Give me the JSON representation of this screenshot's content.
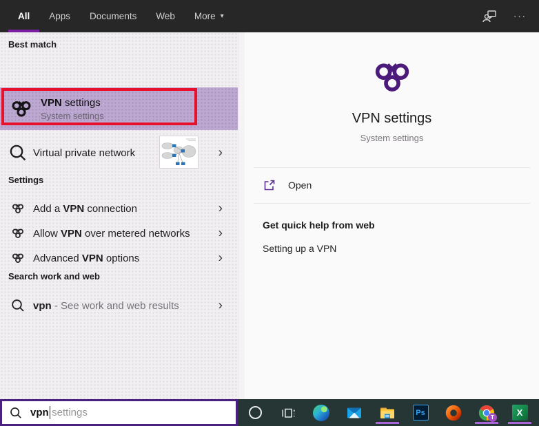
{
  "topbar": {
    "tabs": [
      {
        "label": "All"
      },
      {
        "label": "Apps"
      },
      {
        "label": "Documents"
      },
      {
        "label": "Web"
      },
      {
        "label": "More"
      }
    ],
    "more_arrow": "▾",
    "ellipsis": "···"
  },
  "left": {
    "best_match_header": "Best match",
    "best_match": {
      "title_bold": "VPN",
      "title_rest": " settings",
      "subtitle": "System settings"
    },
    "suggestion": {
      "label": "Virtual private network"
    },
    "settings_header": "Settings",
    "settings_items": [
      {
        "pre": "Add a ",
        "bold": "VPN",
        "post": " connection"
      },
      {
        "pre": "Allow ",
        "bold": "VPN",
        "post": " over metered networks"
      },
      {
        "pre": "Advanced ",
        "bold": "VPN",
        "post": " options"
      }
    ],
    "web_header": "Search work and web",
    "web_item": {
      "query": "vpn",
      "rest": " - See work and web results"
    }
  },
  "right": {
    "title": "VPN settings",
    "subtitle": "System settings",
    "open_label": "Open",
    "help_header": "Get quick help from web",
    "help_item": "Setting up a VPN"
  },
  "search": {
    "typed": "vpn",
    "suggestion": "settings"
  },
  "taskbar": {
    "photoshop_label": "Ps",
    "excel_label": "X",
    "chrome_badge": "T"
  },
  "icons": {
    "chevron_right": "›"
  },
  "colors": {
    "accent_purple": "#7a1fa2",
    "best_match_highlight": "#bca8d0",
    "annotation_red": "#e8112d",
    "vpn_icon_purple": "#4c1a7a",
    "search_border_purple": "#4a217e",
    "taskbar_bg": "#253634",
    "running_indicator": "#a765d6"
  }
}
